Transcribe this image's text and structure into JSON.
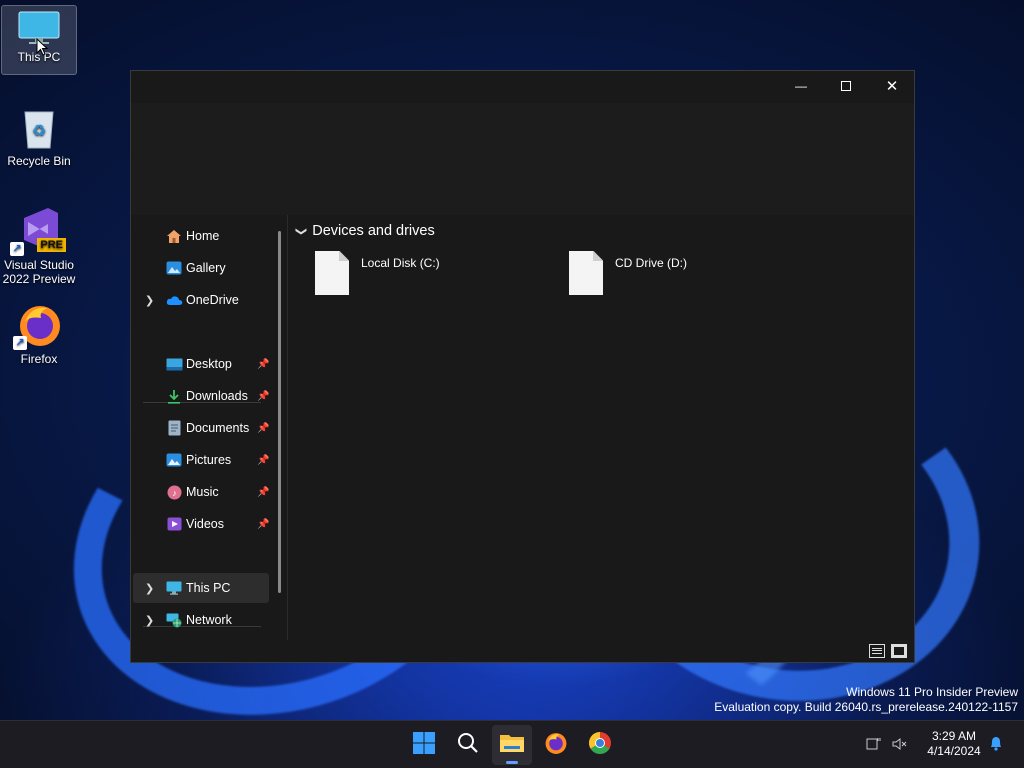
{
  "desktop": {
    "icons": [
      {
        "label": "This PC"
      },
      {
        "label": "Recycle Bin"
      },
      {
        "label": "Visual Studio 2022 Preview",
        "badge": "PRE"
      },
      {
        "label": "Firefox"
      }
    ]
  },
  "window": {
    "controls": {
      "minimize": "—",
      "close": "✕"
    },
    "nav": {
      "items": [
        {
          "label": "Home",
          "icon": "home-icon"
        },
        {
          "label": "Gallery",
          "icon": "gallery-icon"
        },
        {
          "label": "OneDrive",
          "icon": "cloud-icon"
        },
        {
          "label": "Desktop",
          "icon": "desktop-icon"
        },
        {
          "label": "Downloads",
          "icon": "download-icon"
        },
        {
          "label": "Documents",
          "icon": "document-icon"
        },
        {
          "label": "Pictures",
          "icon": "picture-icon"
        },
        {
          "label": "Music",
          "icon": "music-icon"
        },
        {
          "label": "Videos",
          "icon": "video-icon"
        },
        {
          "label": "This PC",
          "icon": "computer-icon"
        },
        {
          "label": "Network",
          "icon": "network-icon"
        }
      ]
    },
    "content": {
      "group_title": "Devices and drives",
      "drives": [
        {
          "label": "Local Disk (C:)"
        },
        {
          "label": "CD Drive (D:)"
        }
      ]
    }
  },
  "watermark": {
    "line1": "Windows 11 Pro Insider Preview",
    "line2": "Evaluation copy. Build 26040.rs_prerelease.240122-1157"
  },
  "taskbar": {
    "time": "3:29 AM",
    "date": "4/14/2024"
  },
  "colors": {
    "accent": "#60a0ff",
    "window_bg": "#191919",
    "taskbar_bg": "#1c1c22"
  }
}
